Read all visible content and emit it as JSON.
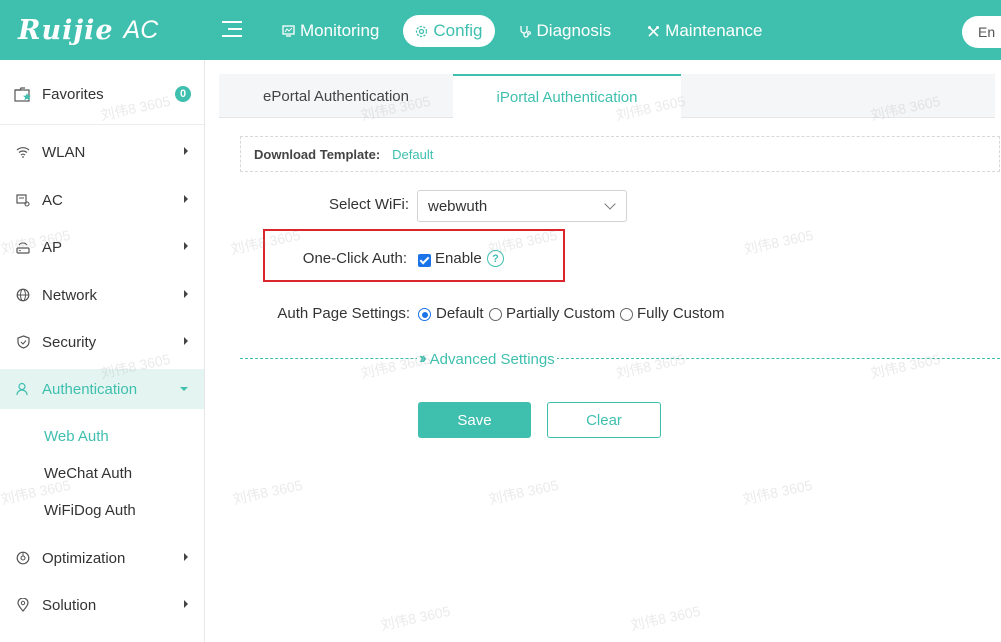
{
  "header": {
    "brand": "Ruijie",
    "product": "AC",
    "nav": [
      {
        "label": "Monitoring",
        "icon": "monitor-icon"
      },
      {
        "label": "Config",
        "icon": "gear-icon"
      },
      {
        "label": "Diagnosis",
        "icon": "stethoscope-icon"
      },
      {
        "label": "Maintenance",
        "icon": "tools-icon"
      }
    ],
    "active_nav": "Config",
    "language": "En"
  },
  "sidebar": {
    "favorites": {
      "label": "Favorites",
      "count": "0"
    },
    "items": [
      {
        "label": "WLAN",
        "icon": "wifi-icon"
      },
      {
        "label": "AC",
        "icon": "ac-icon"
      },
      {
        "label": "AP",
        "icon": "ap-icon"
      },
      {
        "label": "Network",
        "icon": "network-icon"
      },
      {
        "label": "Security",
        "icon": "shield-icon"
      },
      {
        "label": "Authentication",
        "icon": "user-icon"
      },
      {
        "label": "Optimization",
        "icon": "optimization-icon"
      },
      {
        "label": "Solution",
        "icon": "location-pin-icon"
      }
    ],
    "auth_sub": [
      "Web Auth",
      "WeChat Auth",
      "WiFiDog Auth"
    ],
    "active_item": "Authentication",
    "active_sub": "Web Auth"
  },
  "tabs": [
    {
      "label": "ePortal Authentication"
    },
    {
      "label": "iPortal Authentication"
    }
  ],
  "active_tab": "iPortal Authentication",
  "form": {
    "download_label": "Download Template:",
    "download_link": "Default",
    "wifi_label": "Select WiFi:",
    "wifi_value": "webwuth",
    "oneclick_label": "One-Click Auth:",
    "oneclick_option": "Enable",
    "oneclick_checked": true,
    "help_glyph": "?",
    "auth_page_label": "Auth Page Settings:",
    "auth_page_options": [
      "Default",
      "Partially Custom",
      "Fully Custom"
    ],
    "auth_page_selected": "Default",
    "advanced_label": "Advanced Settings",
    "save_label": "Save",
    "clear_label": "Clear"
  },
  "watermark": "刘伟8 3605",
  "colors": {
    "accent": "#3fbfae",
    "highlight": "#d9252b",
    "check": "#1a73e8"
  }
}
